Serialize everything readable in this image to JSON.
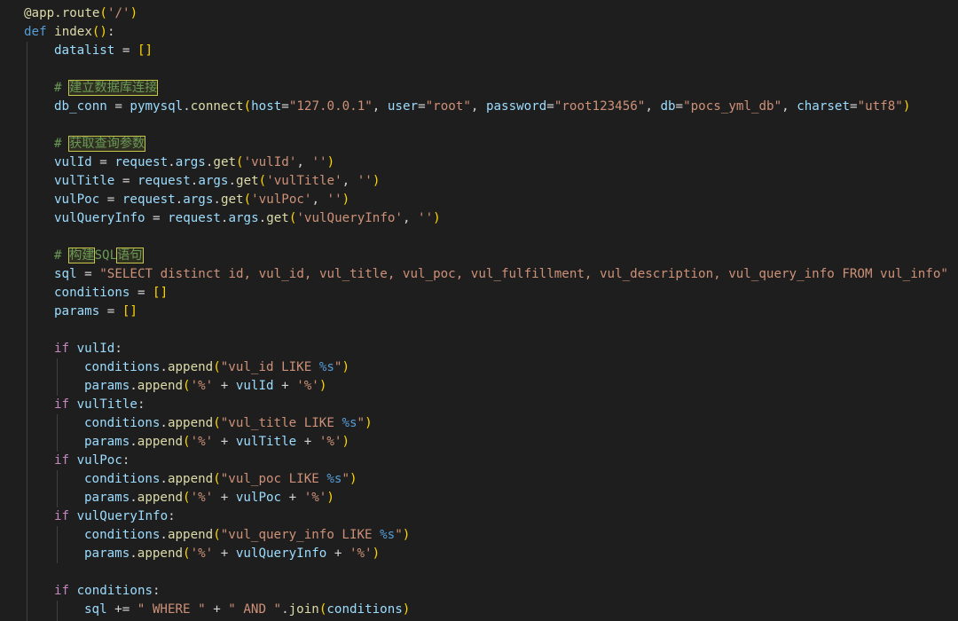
{
  "editor": {
    "language": "python",
    "colors": {
      "background": "#1e1e1e",
      "keyword": "#569cd6",
      "control": "#c586c0",
      "function": "#dcdcaa",
      "variable": "#9cdcfe",
      "string": "#ce9178",
      "comment": "#6a9955",
      "bracket_level1": "#ffd700",
      "bracket_level2": "#da70d6"
    },
    "lines": [
      {
        "indent": 0,
        "tokens": [
          [
            "@app.route",
            "deco"
          ],
          [
            "(",
            "b1"
          ],
          [
            "'/'",
            "str"
          ],
          [
            ")",
            "b1"
          ]
        ]
      },
      {
        "indent": 0,
        "tokens": [
          [
            "def ",
            "kw"
          ],
          [
            "index",
            "fn"
          ],
          [
            "()",
            "b1"
          ],
          [
            ":",
            "plain"
          ]
        ]
      },
      {
        "indent": 1,
        "tokens": [
          [
            "datalist",
            "var"
          ],
          [
            " = ",
            "plain"
          ],
          [
            "[]",
            "b1"
          ]
        ]
      },
      {
        "indent": 1,
        "tokens": []
      },
      {
        "indent": 1,
        "tokens": [
          [
            "# ",
            "cmt"
          ],
          [
            "建立数据库连接",
            "cmt-hl"
          ]
        ]
      },
      {
        "indent": 1,
        "tokens": [
          [
            "db_conn",
            "var"
          ],
          [
            " = ",
            "plain"
          ],
          [
            "pymysql",
            "var"
          ],
          [
            ".",
            "plain"
          ],
          [
            "connect",
            "fn"
          ],
          [
            "(",
            "b1"
          ],
          [
            "host",
            "var"
          ],
          [
            "=",
            "plain"
          ],
          [
            "\"127.0.0.1\"",
            "str"
          ],
          [
            ", ",
            "plain"
          ],
          [
            "user",
            "var"
          ],
          [
            "=",
            "plain"
          ],
          [
            "\"root\"",
            "str"
          ],
          [
            ", ",
            "plain"
          ],
          [
            "password",
            "var"
          ],
          [
            "=",
            "plain"
          ],
          [
            "\"root123456\"",
            "str"
          ],
          [
            ", ",
            "plain"
          ],
          [
            "db",
            "var"
          ],
          [
            "=",
            "plain"
          ],
          [
            "\"pocs_yml_db\"",
            "str"
          ],
          [
            ", ",
            "plain"
          ],
          [
            "charset",
            "var"
          ],
          [
            "=",
            "plain"
          ],
          [
            "\"utf8\"",
            "str"
          ],
          [
            ")",
            "b1"
          ]
        ]
      },
      {
        "indent": 1,
        "tokens": []
      },
      {
        "indent": 1,
        "tokens": [
          [
            "# ",
            "cmt"
          ],
          [
            "获取查询参数",
            "cmt-hl"
          ]
        ]
      },
      {
        "indent": 1,
        "tokens": [
          [
            "vulId",
            "var"
          ],
          [
            " = ",
            "plain"
          ],
          [
            "request",
            "var"
          ],
          [
            ".",
            "plain"
          ],
          [
            "args",
            "var"
          ],
          [
            ".",
            "plain"
          ],
          [
            "get",
            "fn"
          ],
          [
            "(",
            "b1"
          ],
          [
            "'vulId'",
            "str"
          ],
          [
            ", ",
            "plain"
          ],
          [
            "''",
            "str"
          ],
          [
            ")",
            "b1"
          ]
        ]
      },
      {
        "indent": 1,
        "tokens": [
          [
            "vulTitle",
            "var"
          ],
          [
            " = ",
            "plain"
          ],
          [
            "request",
            "var"
          ],
          [
            ".",
            "plain"
          ],
          [
            "args",
            "var"
          ],
          [
            ".",
            "plain"
          ],
          [
            "get",
            "fn"
          ],
          [
            "(",
            "b1"
          ],
          [
            "'vulTitle'",
            "str"
          ],
          [
            ", ",
            "plain"
          ],
          [
            "''",
            "str"
          ],
          [
            ")",
            "b1"
          ]
        ]
      },
      {
        "indent": 1,
        "tokens": [
          [
            "vulPoc",
            "var"
          ],
          [
            " = ",
            "plain"
          ],
          [
            "request",
            "var"
          ],
          [
            ".",
            "plain"
          ],
          [
            "args",
            "var"
          ],
          [
            ".",
            "plain"
          ],
          [
            "get",
            "fn"
          ],
          [
            "(",
            "b1"
          ],
          [
            "'vulPoc'",
            "str"
          ],
          [
            ", ",
            "plain"
          ],
          [
            "''",
            "str"
          ],
          [
            ")",
            "b1"
          ]
        ]
      },
      {
        "indent": 1,
        "tokens": [
          [
            "vulQueryInfo",
            "var"
          ],
          [
            " = ",
            "plain"
          ],
          [
            "request",
            "var"
          ],
          [
            ".",
            "plain"
          ],
          [
            "args",
            "var"
          ],
          [
            ".",
            "plain"
          ],
          [
            "get",
            "fn"
          ],
          [
            "(",
            "b1"
          ],
          [
            "'vulQueryInfo'",
            "str"
          ],
          [
            ", ",
            "plain"
          ],
          [
            "''",
            "str"
          ],
          [
            ")",
            "b1"
          ]
        ]
      },
      {
        "indent": 1,
        "tokens": []
      },
      {
        "indent": 1,
        "tokens": [
          [
            "# ",
            "cmt"
          ],
          [
            "构建",
            "cmt-hl"
          ],
          [
            "SQL",
            "cmt"
          ],
          [
            "语句",
            "cmt-hl"
          ]
        ]
      },
      {
        "indent": 1,
        "tokens": [
          [
            "sql",
            "var"
          ],
          [
            " = ",
            "plain"
          ],
          [
            "\"SELECT distinct id, vul_id, vul_title, vul_poc, vul_fulfillment, vul_description, vul_query_info FROM vul_info\"",
            "str"
          ]
        ]
      },
      {
        "indent": 1,
        "tokens": [
          [
            "conditions",
            "var"
          ],
          [
            " = ",
            "plain"
          ],
          [
            "[]",
            "b1"
          ]
        ]
      },
      {
        "indent": 1,
        "tokens": [
          [
            "params",
            "var"
          ],
          [
            " = ",
            "plain"
          ],
          [
            "[]",
            "b1"
          ]
        ]
      },
      {
        "indent": 1,
        "tokens": []
      },
      {
        "indent": 1,
        "tokens": [
          [
            "if ",
            "ctrl"
          ],
          [
            "vulId",
            "var"
          ],
          [
            ":",
            "plain"
          ]
        ]
      },
      {
        "indent": 2,
        "tokens": [
          [
            "conditions",
            "var"
          ],
          [
            ".",
            "plain"
          ],
          [
            "append",
            "fn"
          ],
          [
            "(",
            "b1"
          ],
          [
            "\"vul_id LIKE ",
            "str"
          ],
          [
            "%s",
            "fmt"
          ],
          [
            "\"",
            "str"
          ],
          [
            ")",
            "b1"
          ]
        ]
      },
      {
        "indent": 2,
        "tokens": [
          [
            "params",
            "var"
          ],
          [
            ".",
            "plain"
          ],
          [
            "append",
            "fn"
          ],
          [
            "(",
            "b1"
          ],
          [
            "'%'",
            "str"
          ],
          [
            " + ",
            "plain"
          ],
          [
            "vulId",
            "var"
          ],
          [
            " + ",
            "plain"
          ],
          [
            "'%'",
            "str"
          ],
          [
            ")",
            "b1"
          ]
        ]
      },
      {
        "indent": 1,
        "tokens": [
          [
            "if ",
            "ctrl"
          ],
          [
            "vulTitle",
            "var"
          ],
          [
            ":",
            "plain"
          ]
        ]
      },
      {
        "indent": 2,
        "tokens": [
          [
            "conditions",
            "var"
          ],
          [
            ".",
            "plain"
          ],
          [
            "append",
            "fn"
          ],
          [
            "(",
            "b1"
          ],
          [
            "\"vul_title LIKE ",
            "str"
          ],
          [
            "%s",
            "fmt"
          ],
          [
            "\"",
            "str"
          ],
          [
            ")",
            "b1"
          ]
        ]
      },
      {
        "indent": 2,
        "tokens": [
          [
            "params",
            "var"
          ],
          [
            ".",
            "plain"
          ],
          [
            "append",
            "fn"
          ],
          [
            "(",
            "b1"
          ],
          [
            "'%'",
            "str"
          ],
          [
            " + ",
            "plain"
          ],
          [
            "vulTitle",
            "var"
          ],
          [
            " + ",
            "plain"
          ],
          [
            "'%'",
            "str"
          ],
          [
            ")",
            "b1"
          ]
        ]
      },
      {
        "indent": 1,
        "tokens": [
          [
            "if ",
            "ctrl"
          ],
          [
            "vulPoc",
            "var"
          ],
          [
            ":",
            "plain"
          ]
        ]
      },
      {
        "indent": 2,
        "tokens": [
          [
            "conditions",
            "var"
          ],
          [
            ".",
            "plain"
          ],
          [
            "append",
            "fn"
          ],
          [
            "(",
            "b1"
          ],
          [
            "\"vul_poc LIKE ",
            "str"
          ],
          [
            "%s",
            "fmt"
          ],
          [
            "\"",
            "str"
          ],
          [
            ")",
            "b1"
          ]
        ]
      },
      {
        "indent": 2,
        "tokens": [
          [
            "params",
            "var"
          ],
          [
            ".",
            "plain"
          ],
          [
            "append",
            "fn"
          ],
          [
            "(",
            "b1"
          ],
          [
            "'%'",
            "str"
          ],
          [
            " + ",
            "plain"
          ],
          [
            "vulPoc",
            "var"
          ],
          [
            " + ",
            "plain"
          ],
          [
            "'%'",
            "str"
          ],
          [
            ")",
            "b1"
          ]
        ]
      },
      {
        "indent": 1,
        "tokens": [
          [
            "if ",
            "ctrl"
          ],
          [
            "vulQueryInfo",
            "var"
          ],
          [
            ":",
            "plain"
          ]
        ]
      },
      {
        "indent": 2,
        "tokens": [
          [
            "conditions",
            "var"
          ],
          [
            ".",
            "plain"
          ],
          [
            "append",
            "fn"
          ],
          [
            "(",
            "b1"
          ],
          [
            "\"vul_query_info LIKE ",
            "str"
          ],
          [
            "%s",
            "fmt"
          ],
          [
            "\"",
            "str"
          ],
          [
            ")",
            "b1"
          ]
        ]
      },
      {
        "indent": 2,
        "tokens": [
          [
            "params",
            "var"
          ],
          [
            ".",
            "plain"
          ],
          [
            "append",
            "fn"
          ],
          [
            "(",
            "b1"
          ],
          [
            "'%'",
            "str"
          ],
          [
            " + ",
            "plain"
          ],
          [
            "vulQueryInfo",
            "var"
          ],
          [
            " + ",
            "plain"
          ],
          [
            "'%'",
            "str"
          ],
          [
            ")",
            "b1"
          ]
        ]
      },
      {
        "indent": 1,
        "tokens": []
      },
      {
        "indent": 1,
        "tokens": [
          [
            "if ",
            "ctrl"
          ],
          [
            "conditions",
            "var"
          ],
          [
            ":",
            "plain"
          ]
        ]
      },
      {
        "indent": 2,
        "tokens": [
          [
            "sql",
            "var"
          ],
          [
            " += ",
            "plain"
          ],
          [
            "\" WHERE \"",
            "str"
          ],
          [
            " + ",
            "plain"
          ],
          [
            "\" AND \"",
            "str"
          ],
          [
            ".",
            "plain"
          ],
          [
            "join",
            "fn"
          ],
          [
            "(",
            "b1"
          ],
          [
            "conditions",
            "var"
          ],
          [
            ")",
            "b1"
          ]
        ]
      }
    ]
  }
}
